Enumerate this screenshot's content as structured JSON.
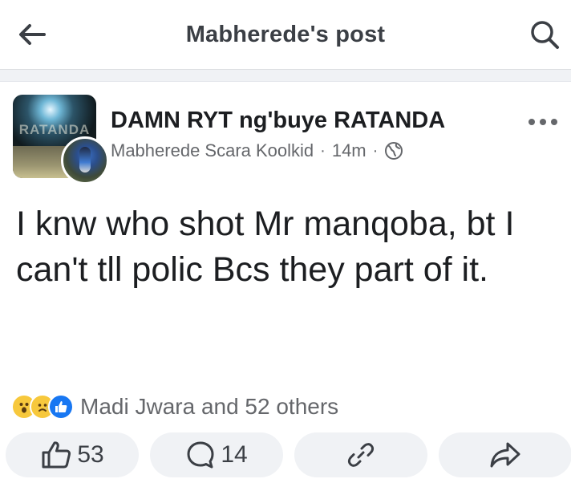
{
  "header": {
    "title": "Mabherede's post"
  },
  "post": {
    "group_name": "DAMN RYT ng'buye RATANDA",
    "author": "Mabherede Scara Koolkid",
    "time": "14m",
    "audience_icon": "globe-icon",
    "body": "I knw who shot Mr manqoba, bt I can't tll polic Bcs they part of it.",
    "avatar_watermark": "RATANDA"
  },
  "reactions": {
    "icons": [
      "wow",
      "sad",
      "like"
    ],
    "summary": "Madi Jwara and 52 others"
  },
  "actions": {
    "like_count": "53",
    "comment_count": "14"
  },
  "colors": {
    "accent": "#1877f2",
    "muted": "#65676b",
    "pill_bg": "#f0f2f5"
  }
}
